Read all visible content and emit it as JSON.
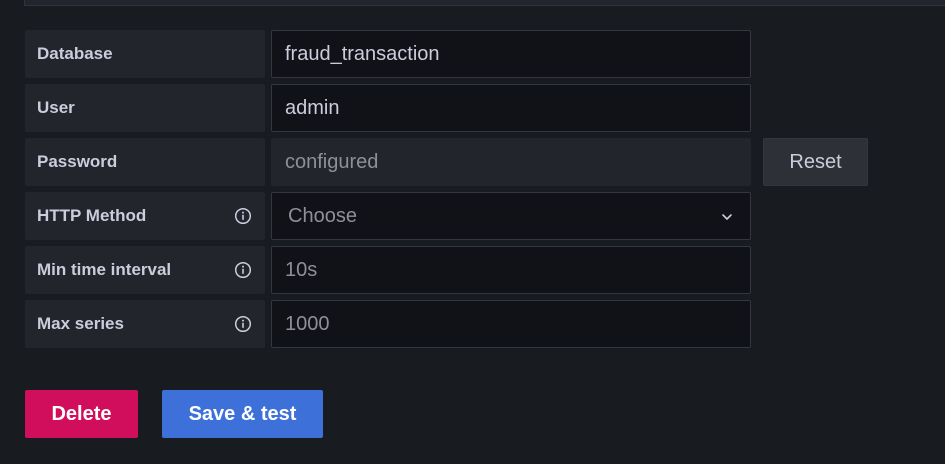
{
  "fields": {
    "database": {
      "label": "Database",
      "value": "fraud_transaction"
    },
    "user": {
      "label": "User",
      "value": "admin"
    },
    "password": {
      "label": "Password",
      "value": "configured",
      "reset_label": "Reset"
    },
    "http_method": {
      "label": "HTTP Method",
      "selected": "Choose"
    },
    "min_time_interval": {
      "label": "Min time interval",
      "placeholder": "10s"
    },
    "max_series": {
      "label": "Max series",
      "placeholder": "1000"
    }
  },
  "actions": {
    "delete_label": "Delete",
    "save_label": "Save & test"
  },
  "colors": {
    "background": "#181b1f",
    "label_bg": "#22252b",
    "input_bg": "#111217",
    "delete": "#d10e5c",
    "primary": "#3d71d9"
  }
}
